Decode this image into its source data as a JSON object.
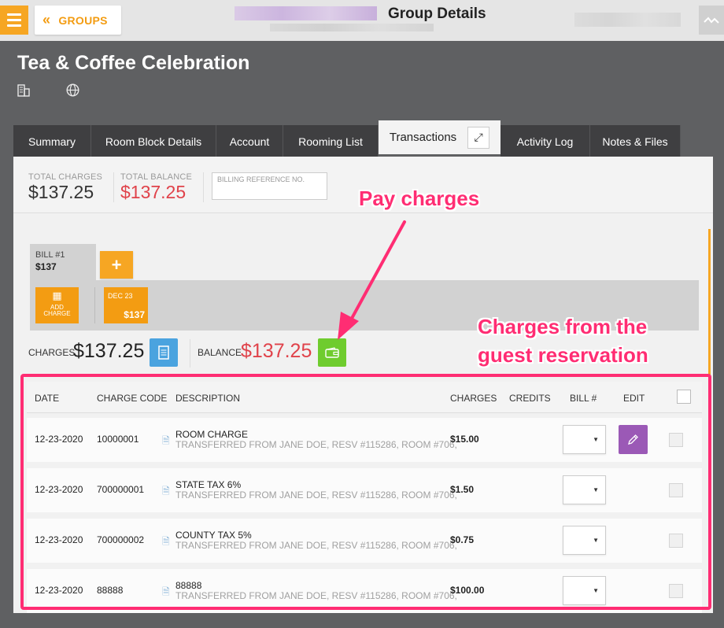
{
  "topbar": {
    "groups_label": "GROUPS",
    "page_heading": "Group Details"
  },
  "group": {
    "title": "Tea & Coffee Celebration"
  },
  "tabs": [
    {
      "label": "Summary"
    },
    {
      "label": "Room Block Details"
    },
    {
      "label": "Account"
    },
    {
      "label": "Rooming List"
    },
    {
      "label": "Transactions"
    },
    {
      "label": "Activity Log"
    },
    {
      "label": "Notes & Files"
    }
  ],
  "totals": {
    "charges_label": "TOTAL CHARGES",
    "charges_value": "$137.25",
    "balance_label": "TOTAL BALANCE",
    "balance_value": "$137.25",
    "billing_ref_placeholder": "BILLING REFERENCE NO."
  },
  "bill": {
    "name": "BILL #1",
    "amount": "$137",
    "add_charge_line1": "ADD",
    "add_charge_line2": "CHARGE",
    "day_label": "DEC 23",
    "day_amount": "$137",
    "charges_label": "CHARGES",
    "charges_value": "$137.25",
    "balance_label": "BALANCE",
    "balance_value": "$137.25"
  },
  "table": {
    "headers": {
      "date": "DATE",
      "charge_code": "CHARGE CODE",
      "description": "DESCRIPTION",
      "charges": "CHARGES",
      "credits": "CREDITS",
      "bill": "BILL #",
      "edit": "EDIT"
    },
    "rows": [
      {
        "date": "12-23-2020",
        "code": "10000001",
        "desc": "ROOM CHARGE",
        "sub": "TRANSFERRED FROM JANE DOE, RESV #115286, ROOM #706,",
        "amount": "$15.00"
      },
      {
        "date": "12-23-2020",
        "code": "700000001",
        "desc": "STATE TAX 6%",
        "sub": "TRANSFERRED FROM JANE DOE, RESV #115286, ROOM #706,",
        "amount": "$1.50"
      },
      {
        "date": "12-23-2020",
        "code": "700000002",
        "desc": "COUNTY TAX 5%",
        "sub": "TRANSFERRED FROM JANE DOE, RESV #115286, ROOM #706,",
        "amount": "$0.75"
      },
      {
        "date": "12-23-2020",
        "code": "88888",
        "desc": "88888",
        "sub": "TRANSFERRED FROM JANE DOE, RESV #115286, ROOM #706,",
        "amount": "$100.00"
      }
    ]
  },
  "annotations": {
    "pay": "Pay charges",
    "charges_line1": "Charges from the",
    "charges_line2": "guest reservation"
  },
  "colors": {
    "accent_orange": "#f6a623",
    "balance_red": "#e0424a",
    "annotation_pink": "#ff2d73",
    "edit_purple": "#9b59b6",
    "pay_green": "#6fcc2e"
  },
  "icons": {
    "menu": "hamburger-icon",
    "back": "double-chevron-left-icon",
    "activity": "activity-icon",
    "building": "building-icon",
    "globe": "globe-icon",
    "expand": "expand-icon",
    "calculator": "calculator-icon",
    "document": "document-icon",
    "wallet": "wallet-icon",
    "pencil": "pencil-icon"
  }
}
